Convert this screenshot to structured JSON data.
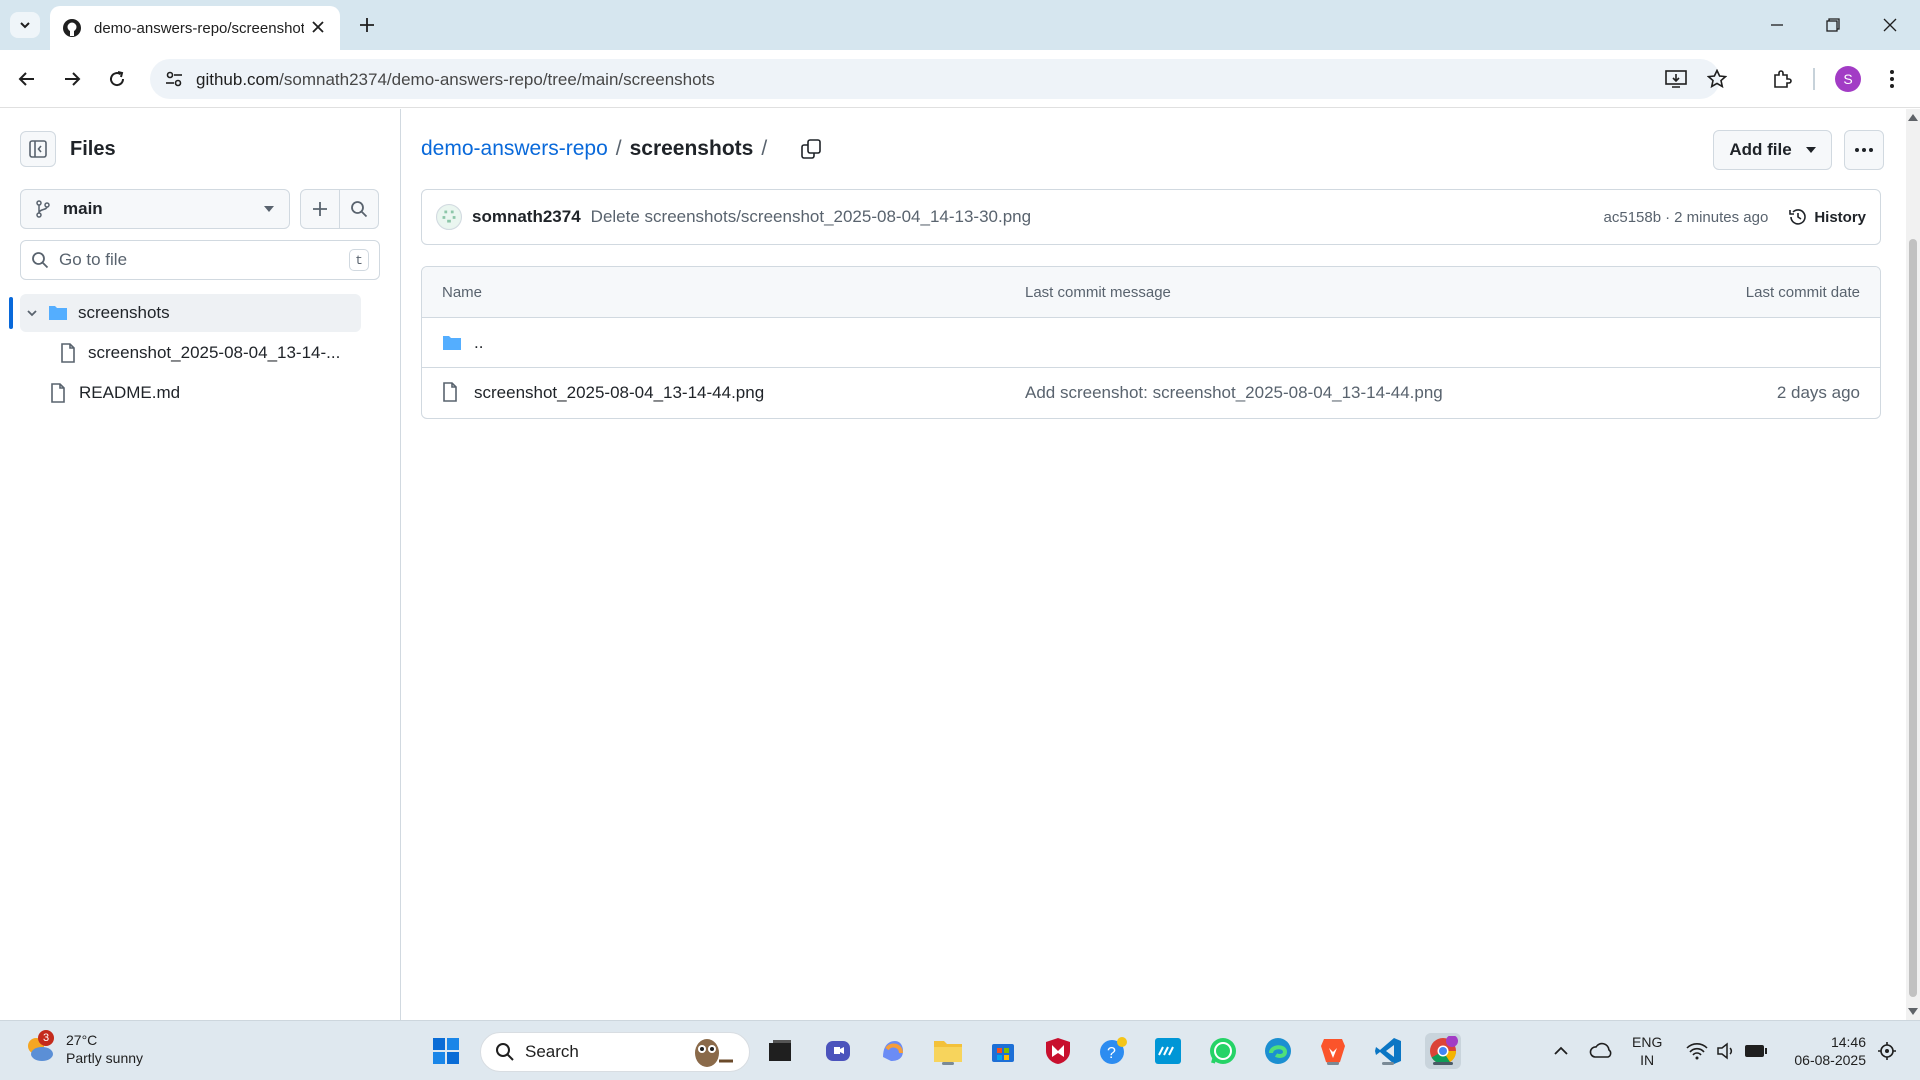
{
  "browser": {
    "tab_title": "demo-answers-repo/screenshots",
    "url_host": "github.com",
    "url_path": "/somnath2374/demo-answers-repo/tree/main/screenshots",
    "profile_initial": "S"
  },
  "sidebar": {
    "title": "Files",
    "branch": "main",
    "goto_placeholder": "Go to file",
    "goto_shortcut": "t",
    "tree": [
      {
        "label": "screenshots",
        "type": "folder",
        "expanded": true
      },
      {
        "label": "screenshot_2025-08-04_13-14-...",
        "type": "file"
      },
      {
        "label": "README.md",
        "type": "file"
      }
    ]
  },
  "breadcrumb": {
    "repo": "demo-answers-repo",
    "separator": "/",
    "current": "screenshots",
    "trailing": "/"
  },
  "actions": {
    "add_file": "Add file"
  },
  "latest_commit": {
    "author": "somnath2374",
    "message": "Delete screenshots/screenshot_2025-08-04_14-13-30.png",
    "sha": "ac5158b",
    "separator": "·",
    "time": "2 minutes ago",
    "history_label": "History"
  },
  "file_table": {
    "headers": [
      "Name",
      "Last commit message",
      "Last commit date"
    ],
    "rows": [
      {
        "name": "..",
        "type": "parent",
        "message": "",
        "date": ""
      },
      {
        "name": "screenshot_2025-08-04_13-14-44.png",
        "type": "file",
        "message": "Add screenshot: screenshot_2025-08-04_13-14-44.png",
        "date": "2 days ago"
      }
    ]
  },
  "taskbar": {
    "weather_badge": "3",
    "temperature": "27°C",
    "condition": "Partly sunny",
    "search_label": "Search",
    "lang_top": "ENG",
    "lang_bottom": "IN",
    "time": "14:46",
    "date": "06-08-2025"
  },
  "colors": {
    "link": "#0969da",
    "folder": "#54aeff",
    "chrome_bg": "#d6e6ef"
  }
}
